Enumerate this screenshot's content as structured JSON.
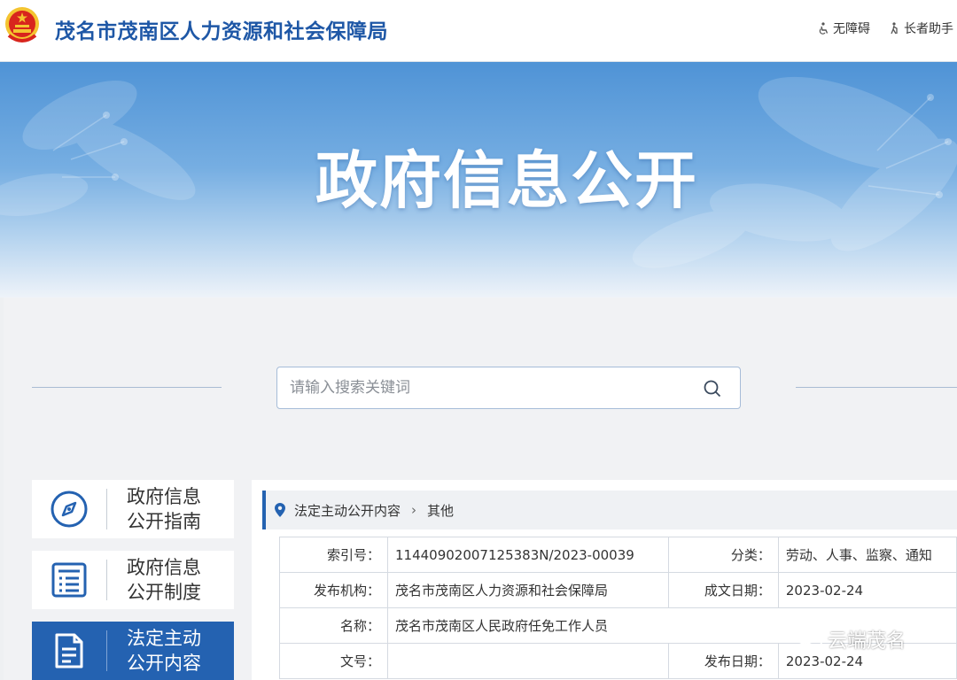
{
  "header": {
    "site_title": "茂名市茂南区人力资源和社会保障局",
    "tools": [
      {
        "label": "无障碍",
        "icon": "accessibility-icon"
      },
      {
        "label": "长者助手",
        "icon": "elder-assist-icon"
      }
    ]
  },
  "banner": {
    "title": "政府信息公开"
  },
  "search": {
    "placeholder": "请输入搜索关键词",
    "value": ""
  },
  "sidebar": {
    "items": [
      {
        "label": "政府信息\n公开指南",
        "icon": "compass-icon",
        "active": false
      },
      {
        "label": "政府信息\n公开制度",
        "icon": "list-document-icon",
        "active": false
      },
      {
        "label": "法定主动\n公开内容",
        "icon": "document-icon",
        "active": true
      }
    ]
  },
  "breadcrumb": {
    "items": [
      "法定主动公开内容",
      "其他"
    ]
  },
  "metadata": {
    "index_label": "索引号：",
    "index_value": "11440902007125383N/2023-00039",
    "category_label": "分类：",
    "category_value": "劳动、人事、监察、通知",
    "publisher_label": "发布机构：",
    "publisher_value": "茂名市茂南区人力资源和社会保障局",
    "created_label": "成文日期：",
    "created_value": "2023-02-24",
    "name_label": "名称：",
    "name_value": "茂名市茂南区人民政府任免工作人员",
    "docno_label": "文号：",
    "docno_value": "",
    "published_label": "发布日期：",
    "published_value": "2023-02-24"
  },
  "watermark": {
    "text": "云端茂名"
  },
  "colors": {
    "brand_blue": "#1e57a6",
    "active_blue": "#2462b1",
    "emblem_red": "#d8251d",
    "emblem_gold": "#f4c430"
  }
}
